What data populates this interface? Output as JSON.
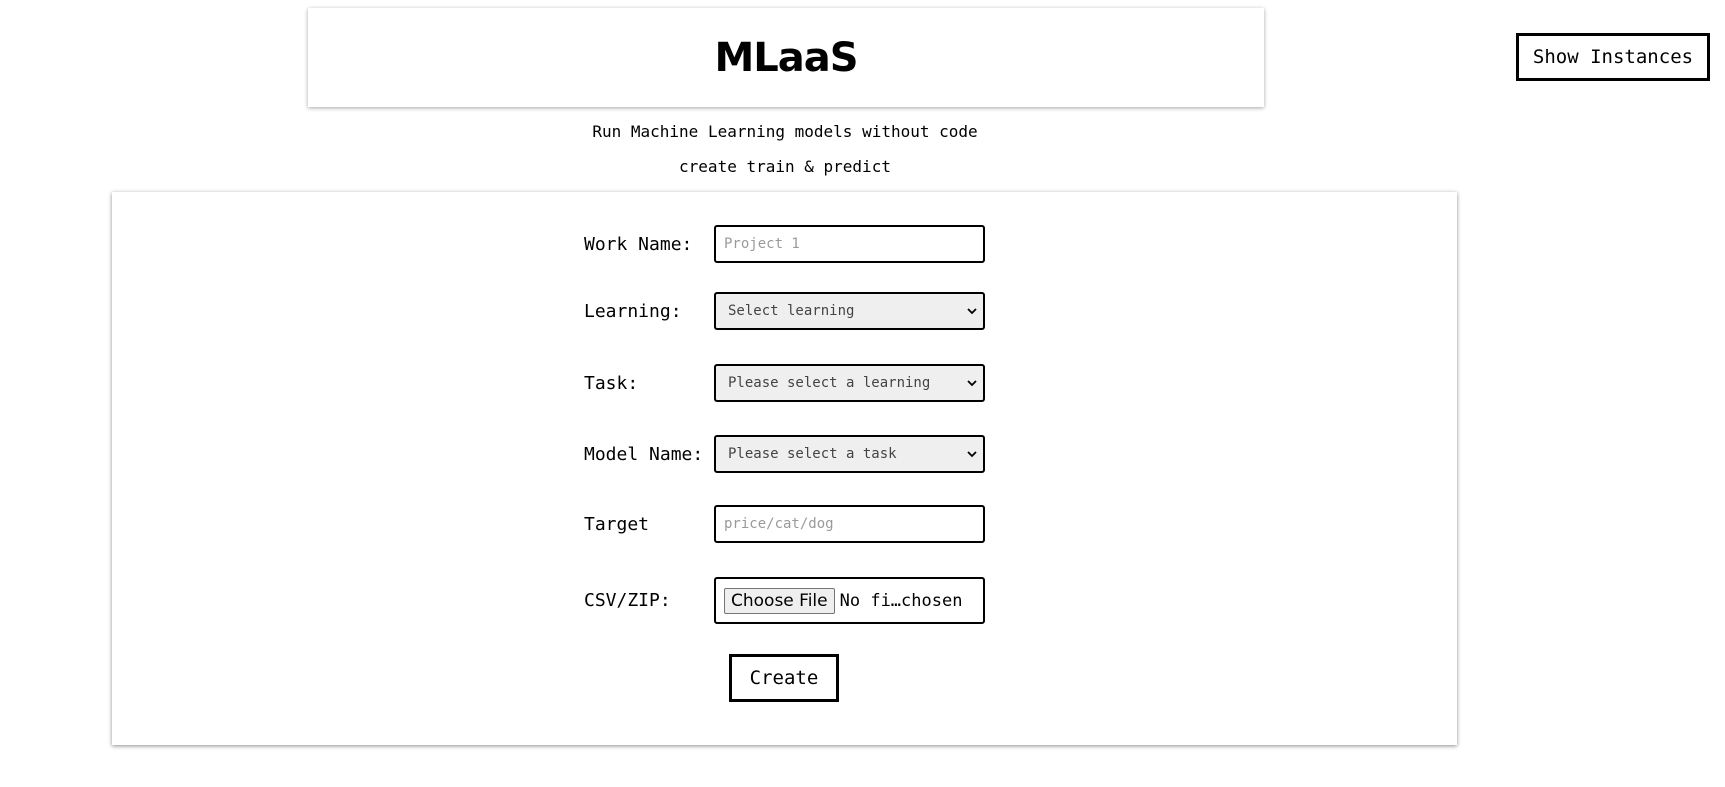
{
  "header": {
    "title": "MLaaS"
  },
  "nav": {
    "show_instances_label": "Show Instances"
  },
  "taglines": {
    "line1": "Run Machine Learning models without code",
    "line2": "create train & predict"
  },
  "form": {
    "work_name": {
      "label": "Work Name:",
      "placeholder": "Project 1",
      "value": ""
    },
    "learning": {
      "label": "Learning:",
      "selected": "Select learning"
    },
    "task": {
      "label": "Task:",
      "selected": "Please select a learning"
    },
    "model_name": {
      "label": "Model Name:",
      "selected": "Please select a task"
    },
    "target": {
      "label": "Target",
      "placeholder": "price/cat/dog",
      "value": ""
    },
    "csv_zip": {
      "label": "CSV/ZIP:",
      "button_label": "Choose File",
      "status": "No fi…chosen"
    },
    "create_label": "Create"
  }
}
